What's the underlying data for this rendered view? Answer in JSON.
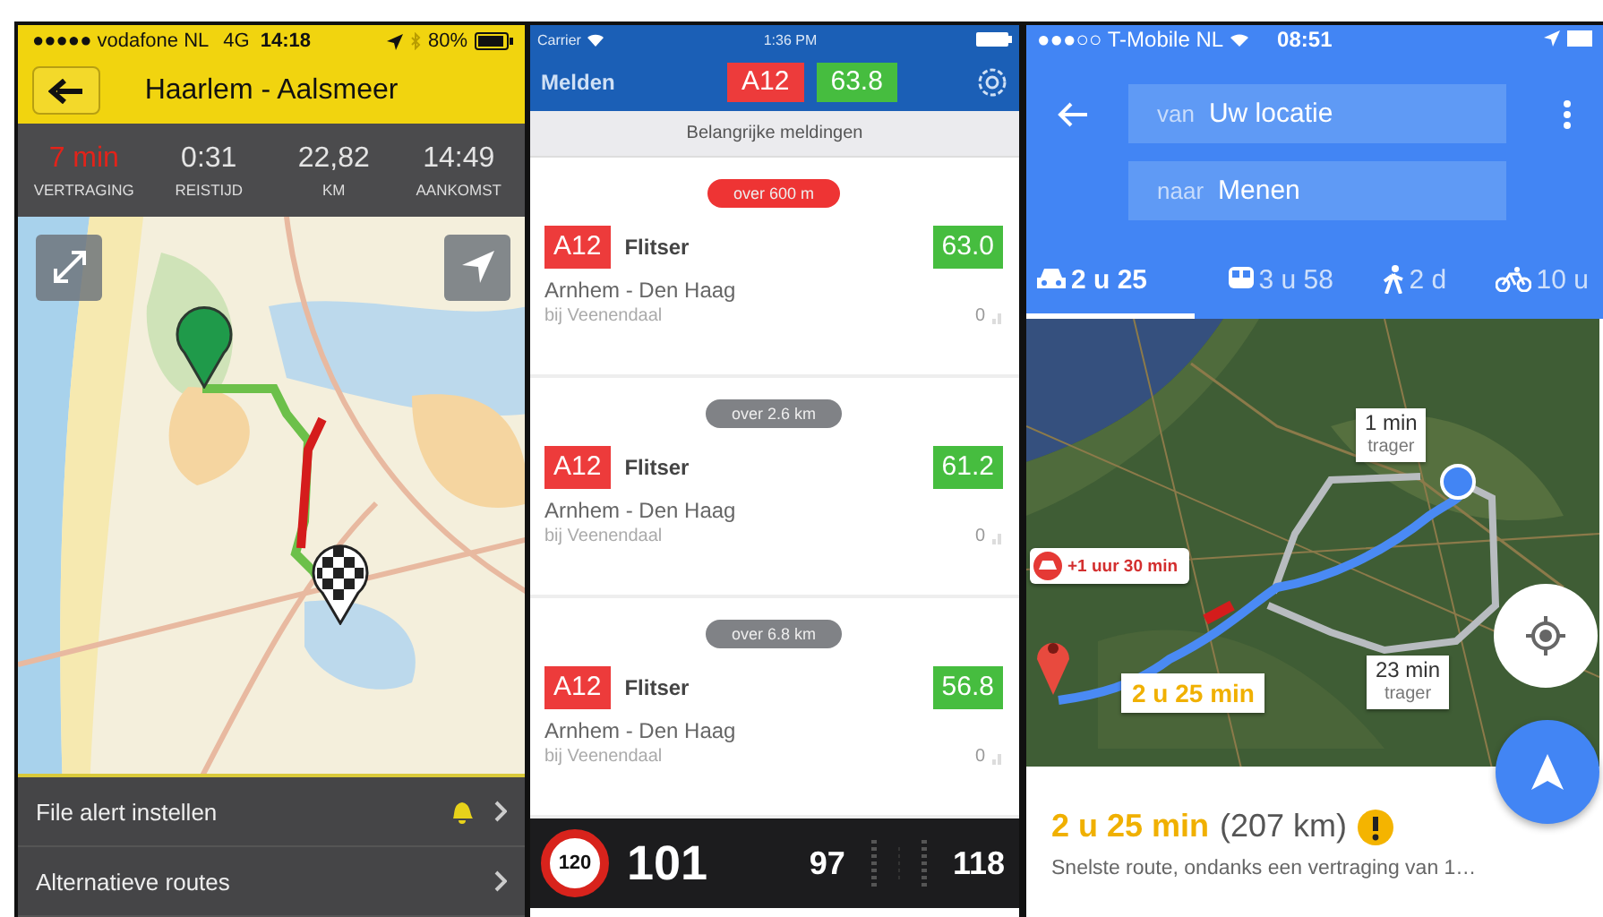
{
  "left_app": {
    "status_bar": {
      "carrier": "●●●●● vodafone NL",
      "network": "4G",
      "time": "14:18",
      "battery": "80%"
    },
    "title": "Haarlem - Aalsmeer",
    "stats": [
      {
        "value": "7 min",
        "label": "VERTRAGING",
        "alert": true
      },
      {
        "value": "0:31",
        "label": "REISTIJD",
        "alert": false
      },
      {
        "value": "22,82",
        "label": "KM",
        "alert": false
      },
      {
        "value": "14:49",
        "label": "AANKOMST",
        "alert": false
      }
    ],
    "menu": [
      {
        "label": "File alert instellen",
        "kind": "bell"
      },
      {
        "label": "Alternatieve routes",
        "kind": "plain"
      }
    ]
  },
  "middle_app": {
    "status_bar": {
      "carrier": "Carrier",
      "time": "1:36 PM"
    },
    "header": {
      "title": "Melden",
      "road": "A12",
      "speed": "63.8"
    },
    "section": "Belangrijke meldingen",
    "alerts": [
      {
        "distance": "over 600 m",
        "urgent": true,
        "road": "A12",
        "type": "Flitser",
        "speed": "63.0",
        "route": "Arnhem - Den Haag",
        "location": "bij Veenendaal",
        "count": "0"
      },
      {
        "distance": "over 2.6 km",
        "urgent": false,
        "road": "A12",
        "type": "Flitser",
        "speed": "61.2",
        "route": "Arnhem - Den Haag",
        "location": "bij Veenendaal",
        "count": "0"
      },
      {
        "distance": "over 6.8 km",
        "urgent": false,
        "road": "A12",
        "type": "Flitser",
        "speed": "56.8",
        "route": "Arnhem - Den Haag",
        "location": "bij Veenendaal",
        "count": "0"
      }
    ],
    "footer": {
      "limit": "120",
      "speed": "101",
      "min": "97",
      "max": "118"
    }
  },
  "right_app": {
    "status_bar": {
      "carrier": "●●●○○ T-Mobile NL",
      "time": "08:51"
    },
    "from": {
      "prefix": "van",
      "value": "Uw locatie"
    },
    "to": {
      "prefix": "naar",
      "value": "Menen"
    },
    "modes": [
      {
        "kind": "car",
        "label": "2 u 25",
        "selected": true
      },
      {
        "kind": "transit",
        "label": "3 u 58",
        "selected": false
      },
      {
        "kind": "walk",
        "label": "2 d",
        "selected": false
      },
      {
        "kind": "bike",
        "label": "10 u",
        "selected": false
      }
    ],
    "callouts": [
      {
        "kind": "delay",
        "text": "+1 uur 30 min"
      },
      {
        "kind": "primary",
        "text": "2 u 25 min"
      },
      {
        "kind": "alt",
        "text": "1 min",
        "subtext": "trager"
      },
      {
        "kind": "alt",
        "text": "23 min",
        "subtext": "trager"
      }
    ],
    "summary": {
      "duration": "2 u 25 min",
      "distance": "(207 km)",
      "warning": true,
      "description": "Snelste route, ondanks een vertraging van 1…"
    }
  }
}
